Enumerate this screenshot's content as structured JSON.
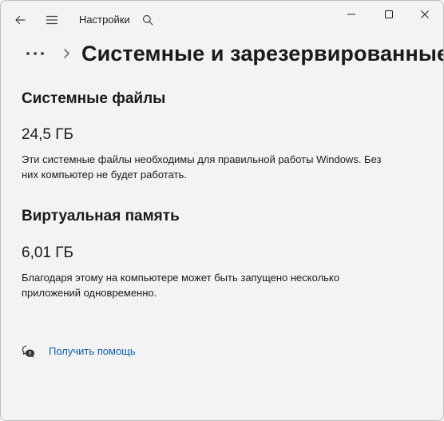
{
  "titlebar": {
    "app_title": "Настройки",
    "back_icon": "back-arrow-icon",
    "menu_icon": "hamburger-menu-icon",
    "search_icon": "search-icon",
    "minimize_icon": "minimize-icon",
    "maximize_icon": "maximize-icon",
    "close_icon": "close-icon"
  },
  "header": {
    "breadcrumb_more_icon": "more-dots-icon",
    "breadcrumb_separator_icon": "chevron-right-icon",
    "title": "Системные и зарезервированные"
  },
  "sections": [
    {
      "title": "Системные файлы",
      "size": "24,5 ГБ",
      "description": "Эти системные файлы необходимы для правильной работы Windows. Без них компьютер не будет работать."
    },
    {
      "title": "Виртуальная память",
      "size": "6,01 ГБ",
      "description": "Благодаря этому на компьютере может быть запущено несколько приложений одновременно."
    }
  ],
  "help": {
    "icon": "help-chat-icon",
    "label": "Получить помощь"
  },
  "colors": {
    "background": "#f3f3f3",
    "text": "#1a1a1a",
    "link": "#0a5ea8"
  }
}
